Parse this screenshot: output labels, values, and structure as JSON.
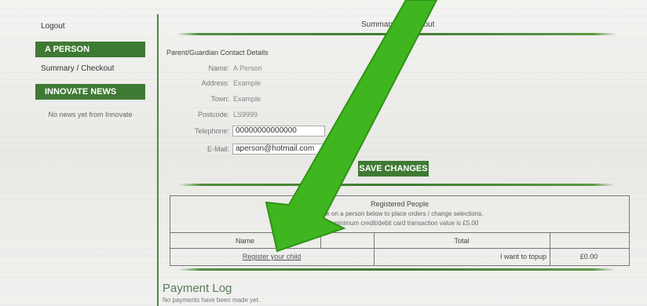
{
  "sidebar": {
    "logout": "Logout",
    "person_heading": "A PERSON",
    "summary_link": "Summary / Checkout",
    "news_heading": "INNOVATE NEWS",
    "news_text": "No news yet from Innovate"
  },
  "main": {
    "page_title": "Summary / Checkout",
    "contact_heading": "Parent/Guardian Contact Details",
    "fields": {
      "name_label": "Name:",
      "name_value": "A Person",
      "address_label": "Address:",
      "address_value": "Example",
      "town_label": "Town:",
      "town_value": "Example",
      "postcode_label": "Postcode:",
      "postcode_value": "LS9999",
      "telephone_label": "Telephone:",
      "telephone_value": "00000000000000",
      "email_label": "E-Mail:",
      "email_value": "aperson@hotmail.com"
    },
    "save_button": "SAVE CHANGES",
    "registered": {
      "title": "Registered People",
      "note1": "Click on a person below to place orders / change selections.",
      "note2": "The minimum credit/debit card transaction value is £5.00",
      "col_name": "Name",
      "col_total": "Total",
      "register_link": "Register your child",
      "topup_label": "I want to topup",
      "topup_amount": "£0.00"
    },
    "payment_log": {
      "title": "Payment Log",
      "text": "No payments have been made yet."
    }
  },
  "colors": {
    "brand_green": "#3f7a34",
    "arrow_green": "#3fb51f"
  }
}
